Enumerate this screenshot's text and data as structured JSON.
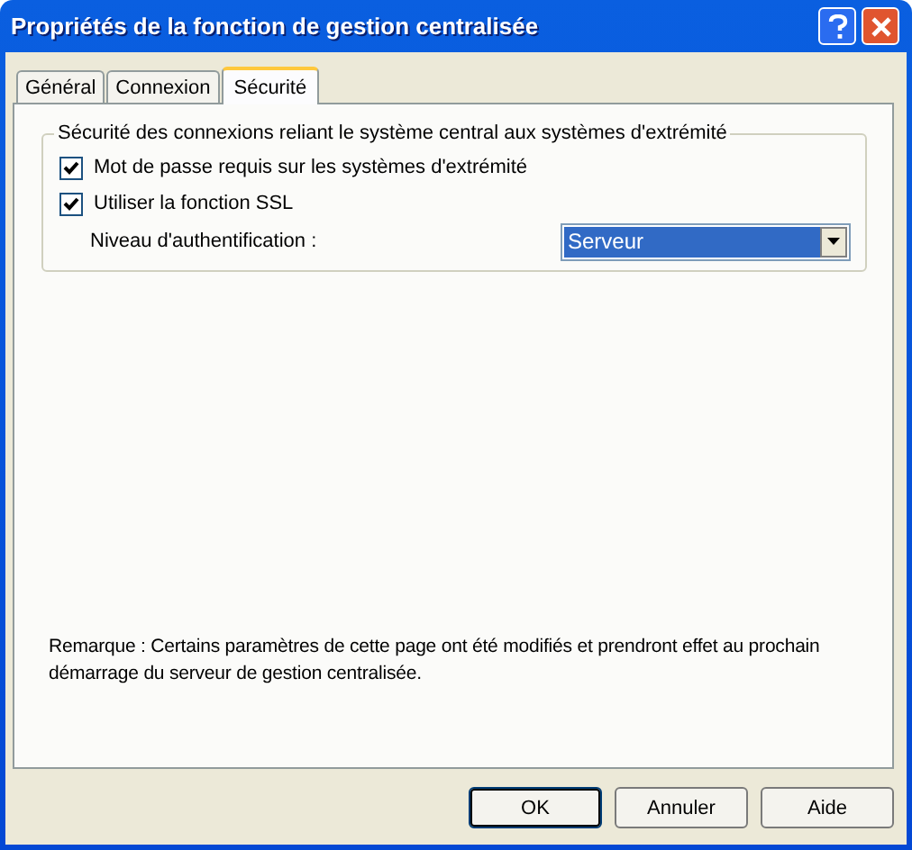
{
  "window": {
    "title": "Propriétés de la fonction de gestion centralisée"
  },
  "tabs": [
    {
      "label": "Général",
      "selected": false
    },
    {
      "label": "Connexion",
      "selected": false
    },
    {
      "label": "Sécurité",
      "selected": true
    }
  ],
  "group": {
    "title": "Sécurité des connexions reliant le système central aux systèmes d'extrémité",
    "checkboxes": [
      {
        "label": "Mot de passe requis sur les systèmes d'extrémité",
        "checked": true
      },
      {
        "label": "Utiliser la fonction SSL",
        "checked": true
      }
    ],
    "auth_level": {
      "label": "Niveau d'authentification :",
      "value": "Serveur"
    }
  },
  "note": "Remarque : Certains paramètres de cette page ont été modifiés et prendront effet au prochain démarrage du serveur de gestion centralisée.",
  "buttons": [
    {
      "label": "OK",
      "default": true
    },
    {
      "label": "Annuler",
      "default": false
    },
    {
      "label": "Aide",
      "default": false
    }
  ]
}
